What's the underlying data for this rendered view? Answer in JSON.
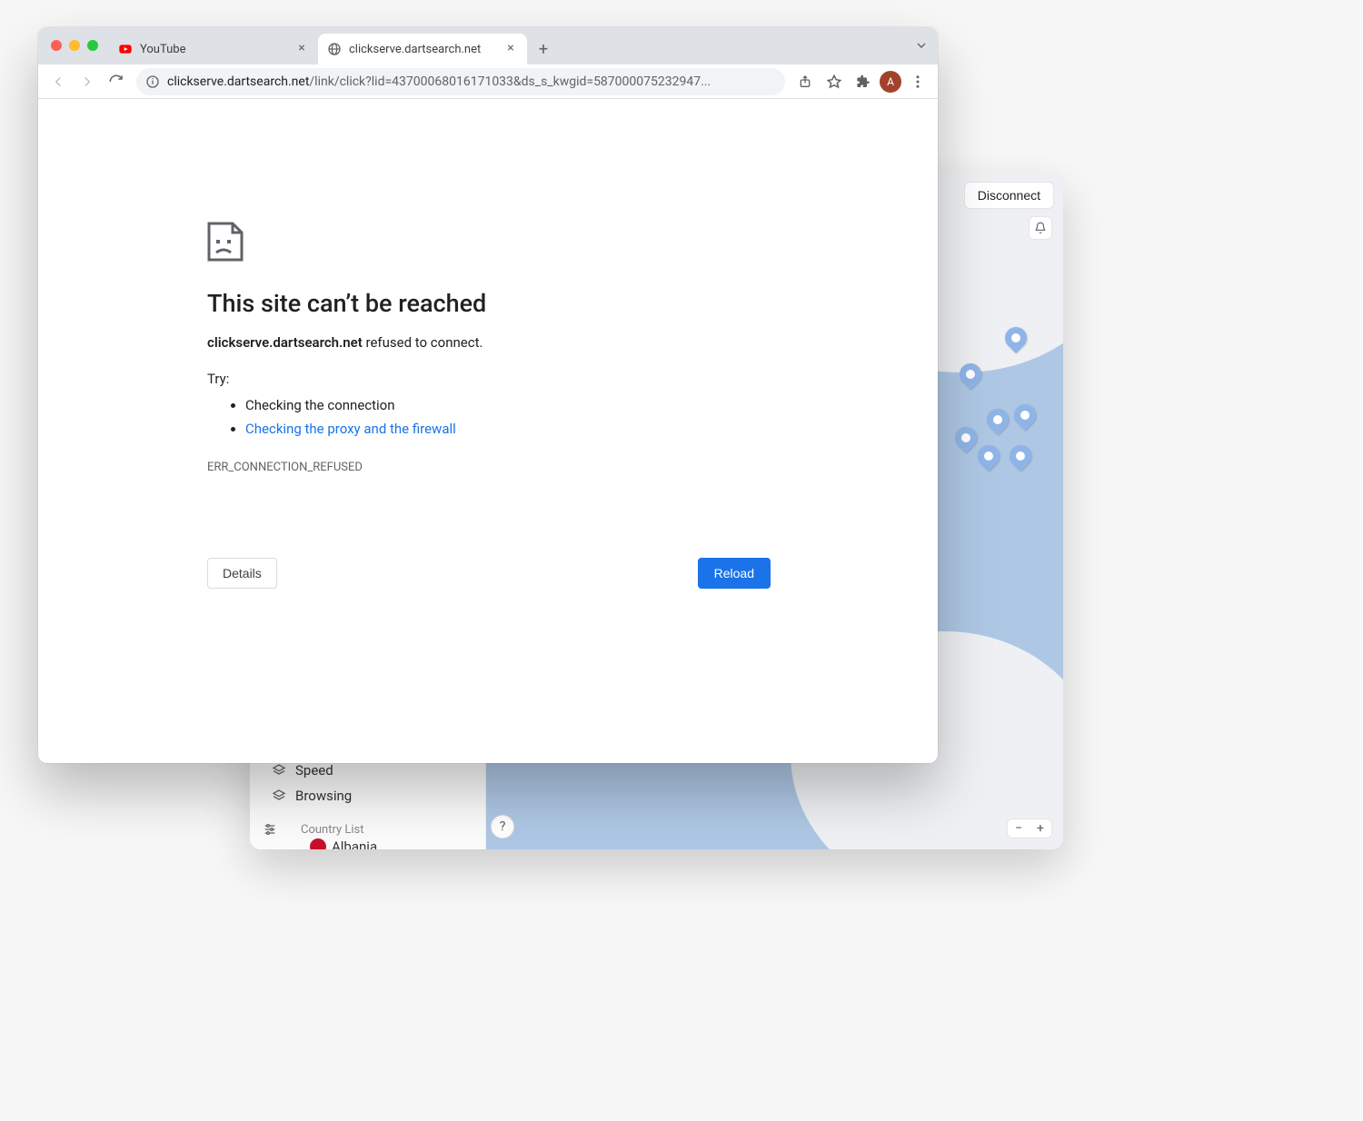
{
  "browser": {
    "tabs": [
      {
        "favicon": "youtube",
        "title": "YouTube",
        "active": false
      },
      {
        "favicon": "globe",
        "title": "clickserve.dartsearch.net",
        "active": true
      }
    ],
    "url_host": "clickserve.dartsearch.net",
    "url_path": "/link/click?lid=43700068016171033&ds_s_kwgid=587000075232947...",
    "avatar_letter": "A"
  },
  "error_page": {
    "title": "This site can’t be reached",
    "host_bold": "clickserve.dartsearch.net",
    "host_suffix": " refused to connect.",
    "try_label": "Try:",
    "suggestions": [
      {
        "text": "Checking the connection",
        "link": false
      },
      {
        "text": "Checking the proxy and the firewall",
        "link": true
      }
    ],
    "error_code": "ERR_CONNECTION_REFUSED",
    "details_label": "Details",
    "reload_label": "Reload"
  },
  "secondary_app": {
    "disconnect_label": "Disconnect",
    "sidebar": {
      "items": [
        {
          "label": "Speed"
        },
        {
          "label": "Browsing"
        }
      ],
      "country_heading": "Country List",
      "first_country": "Albania"
    },
    "help_label": "?",
    "zoom_minus": "−",
    "zoom_plus": "+"
  }
}
